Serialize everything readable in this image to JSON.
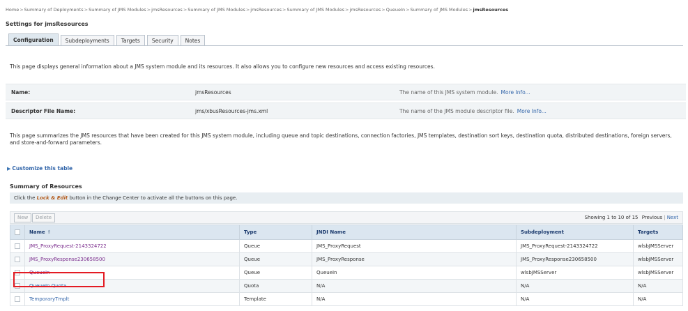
{
  "breadcrumb": {
    "items": [
      "Home",
      "Summary of Deployments",
      "Summary of JMS Modules",
      "jmsResources",
      "Summary of JMS Modules",
      "jmsResources",
      "Summary of JMS Modules",
      "jmsResources",
      "QueueIn",
      "Summary of JMS Modules",
      "jmsResources"
    ],
    "separator": ">"
  },
  "settings_title": "Settings for jmsResources",
  "tabs": [
    "Configuration",
    "Subdeployments",
    "Targets",
    "Security",
    "Notes"
  ],
  "intro": "This page displays general information about a JMS system module and its resources. It also allows you to configure new resources and access existing resources.",
  "info": {
    "name": {
      "label": "Name:",
      "value": "jmsResources",
      "help": "The name of this JMS system module.",
      "more": "More Info..."
    },
    "descriptor": {
      "label": "Descriptor File Name:",
      "value": "jms/xbusResources-jms.xml",
      "help": "The name of the JMS module descriptor file.",
      "more": "More Info..."
    }
  },
  "summary_text": "This page summarizes the JMS resources that have been created for this JMS system module, including queue and topic destinations, connection factories, JMS templates, destination sort keys, destination quota, distributed destinations, foreign servers, and store-and-forward parameters.",
  "customize_link": "Customize this table",
  "resources_title": "Summary of Resources",
  "lock_notice": {
    "before": "Click the",
    "lock": "Lock & Edit",
    "after": "button in the Change Center to activate all the buttons on this page."
  },
  "toolbar": {
    "new_label": "New",
    "delete_label": "Delete",
    "paging_text": "Showing 1 to 10 of 15",
    "previous_label": "Previous",
    "separator": "|",
    "next_label": "Next"
  },
  "table": {
    "columns": [
      "Name",
      "Type",
      "JNDI Name",
      "Subdeployment",
      "Targets"
    ],
    "rows": [
      {
        "name": "JMS_ProxyRequest-2143324722",
        "type": "Queue",
        "jndi": "JMS_ProxyRequest",
        "subdeployment": "JMS_ProxyRequest-2143324722",
        "targets": "wlsbJMSServer"
      },
      {
        "name": "JMS_ProxyResponse230658500",
        "type": "Queue",
        "jndi": "JMS_ProxyResponse",
        "subdeployment": "JMS_ProxyResponse230658500",
        "targets": "wlsbJMSServer"
      },
      {
        "name": "QueueIn",
        "type": "Queue",
        "jndi": "QueueIn",
        "subdeployment": "wlsbJMSServer",
        "targets": "wlsbJMSServer"
      },
      {
        "name": "QueueIn.Quota",
        "type": "Quota",
        "jndi": "N/A",
        "subdeployment": "N/A",
        "targets": "N/A"
      },
      {
        "name": "TemporaryTmplt",
        "type": "Template",
        "jndi": "N/A",
        "subdeployment": "N/A",
        "targets": "N/A"
      }
    ]
  },
  "colors": {
    "header_bg": "#dbe6f0",
    "link_visited": "#7a2c8c",
    "link": "#3366aa",
    "highlight": "#e31b23"
  }
}
